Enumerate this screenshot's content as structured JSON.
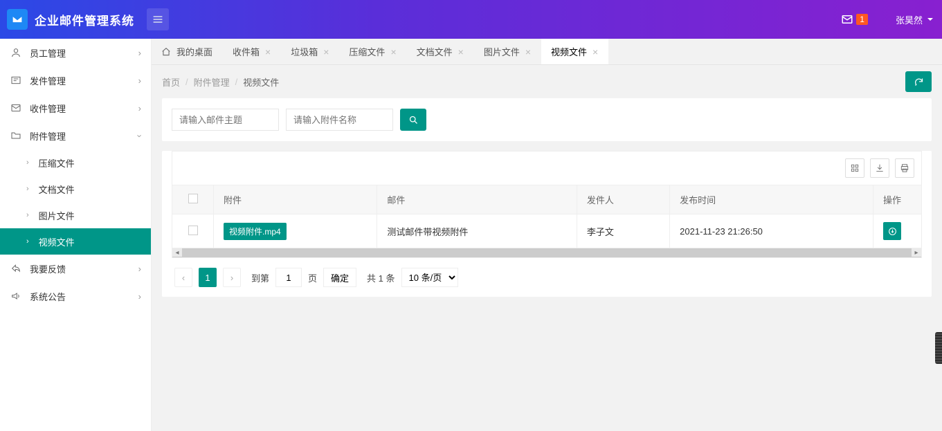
{
  "header": {
    "app_title": "企业邮件管理系统",
    "notif_count": "1",
    "user_name": "张昊然"
  },
  "sidebar": {
    "items": [
      {
        "label": "员工管理"
      },
      {
        "label": "发件管理"
      },
      {
        "label": "收件管理"
      },
      {
        "label": "附件管理"
      }
    ],
    "sub_items": [
      {
        "label": "压缩文件"
      },
      {
        "label": "文档文件"
      },
      {
        "label": "图片文件"
      },
      {
        "label": "视频文件"
      }
    ],
    "tail_items": [
      {
        "label": "我要反馈"
      },
      {
        "label": "系统公告"
      }
    ]
  },
  "tabs": [
    {
      "label": "我的桌面",
      "closable": false
    },
    {
      "label": "收件箱",
      "closable": true
    },
    {
      "label": "垃圾箱",
      "closable": true
    },
    {
      "label": "压缩文件",
      "closable": true
    },
    {
      "label": "文档文件",
      "closable": true
    },
    {
      "label": "图片文件",
      "closable": true
    },
    {
      "label": "视频文件",
      "closable": true,
      "active": true
    }
  ],
  "breadcrumb": {
    "home": "首页",
    "mid": "附件管理",
    "cur": "视频文件"
  },
  "filter": {
    "subject_placeholder": "请输入邮件主题",
    "attach_placeholder": "请输入附件名称"
  },
  "table": {
    "headers": {
      "attach": "附件",
      "mail": "邮件",
      "sender": "发件人",
      "time": "发布时间",
      "op": "操作"
    },
    "rows": [
      {
        "attach": "视频附件.mp4",
        "mail": "测试邮件带视频附件",
        "sender": "李子文",
        "time": "2021-11-23 21:26:50"
      }
    ]
  },
  "pager": {
    "page": "1",
    "goto_label": "到第",
    "page_unit": "页",
    "confirm": "确定",
    "total_label": "共 1 条",
    "page_size": "10 条/页"
  }
}
